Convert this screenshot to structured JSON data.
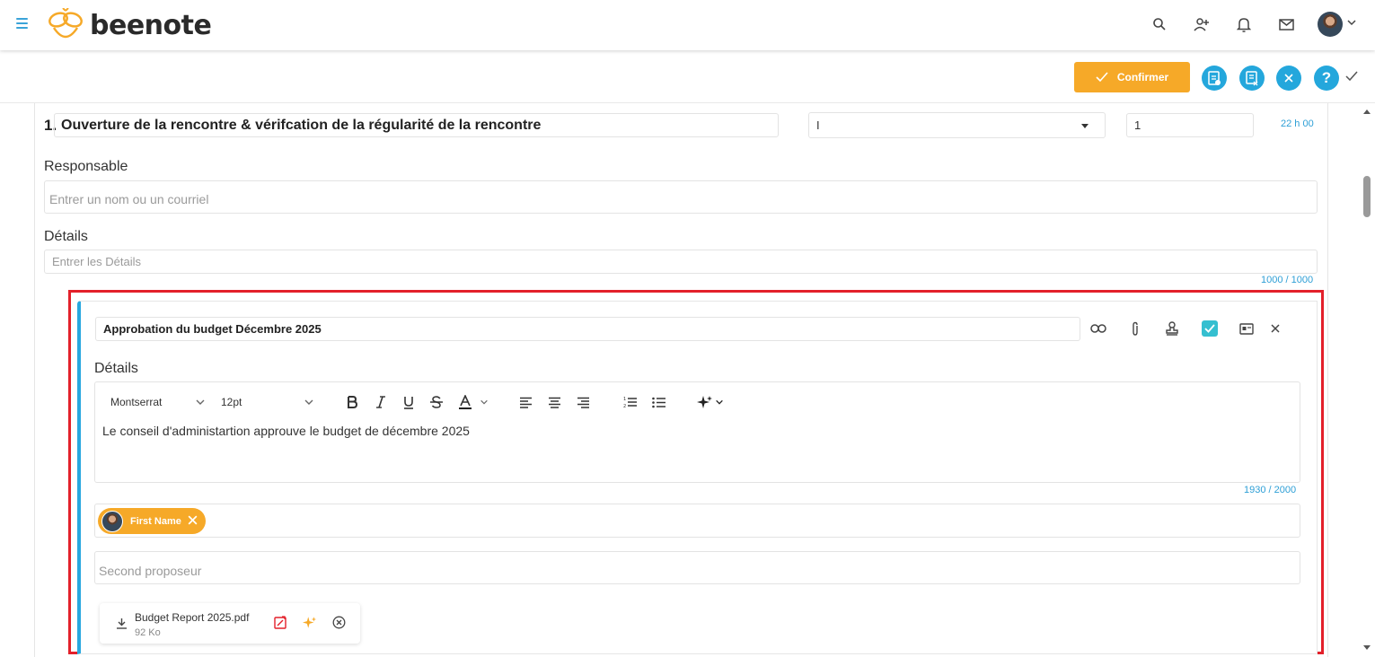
{
  "header": {
    "logo_text": "beenote",
    "icons": [
      "menu-icon",
      "search-icon",
      "add-user-icon",
      "bell-icon",
      "mail-icon",
      "avatar",
      "chevron-down-icon"
    ]
  },
  "actionbar": {
    "confirm_label": "Confirmer",
    "buttons": [
      "clipboard-icon",
      "document-close-icon",
      "close-icon",
      "help-icon",
      "check-icon"
    ],
    "help_glyph": "?"
  },
  "agenda_item": {
    "number": "1.",
    "title": "Ouverture de la rencontre & vérifcation de la régularité de la rencontre",
    "select_value": "I",
    "number_value": "1",
    "time": "22 h 00",
    "responsable_label": "Responsable",
    "responsable_placeholder": "Entrer un nom ou un courriel",
    "details_label": "Détails",
    "details_placeholder": "Entrer les Détails",
    "details_counter": "1000 / 1000"
  },
  "subitem": {
    "title": "Approbation du budget Décembre 2025",
    "details_label": "Détails",
    "font_family": "Montserrat",
    "font_size": "12pt",
    "text": "Le conseil d'administartion approuve le budget de décembre 2025",
    "counter": "1930 / 2000",
    "proposer_chip": "First Name",
    "second_proposer_placeholder": "Second proposeur",
    "attachment": {
      "name": "Budget Report 2025.pdf",
      "size": "92 Ko"
    }
  },
  "colors": {
    "accent_orange": "#f6a928",
    "accent_blue": "#24a7dc",
    "highlight_red": "#e3202a",
    "teal": "#35bfd0"
  }
}
